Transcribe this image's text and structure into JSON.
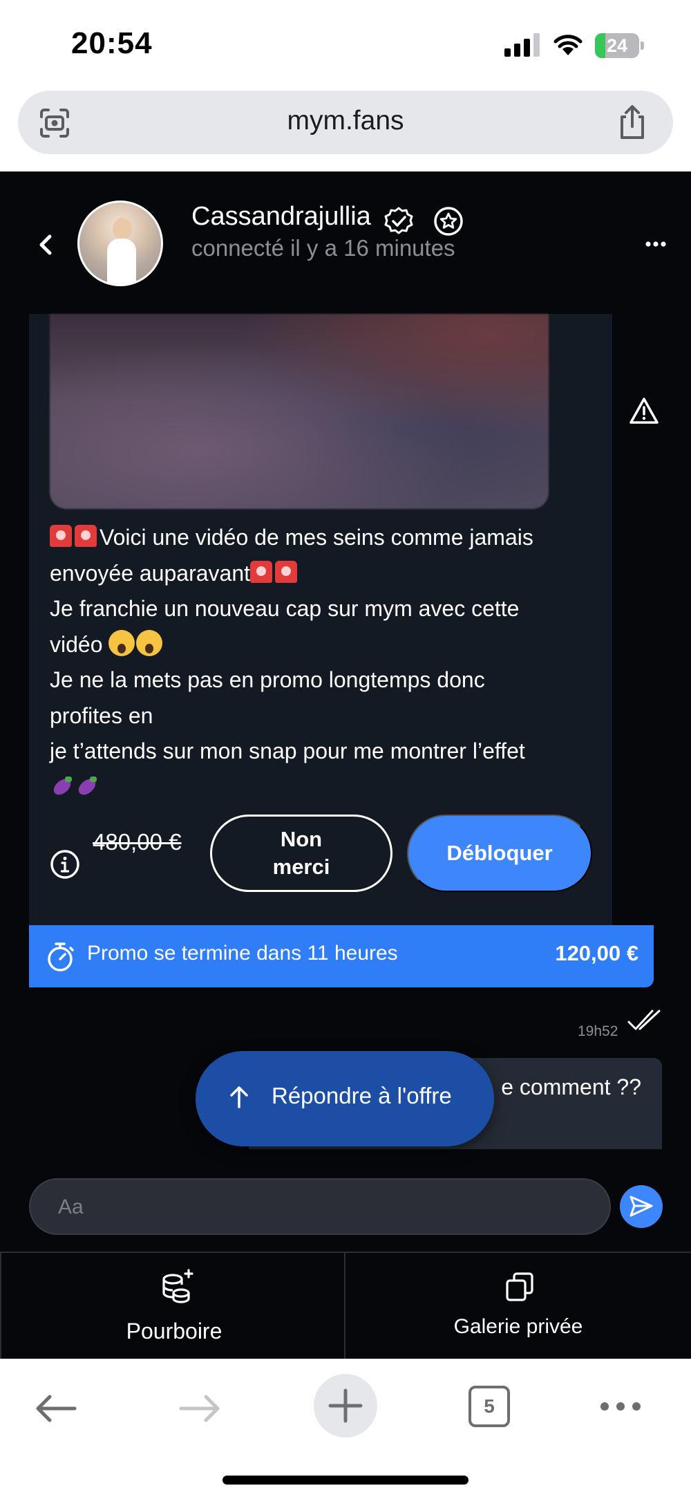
{
  "status_bar": {
    "time": "20:54",
    "battery": "24",
    "battery_level": 0.24,
    "battery_color": "#35c759"
  },
  "browser": {
    "url": "mym.fans",
    "tabs_count": "5",
    "icons": [
      "camera-search-icon",
      "share-icon",
      "back-arrow-icon",
      "forward-arrow-icon",
      "plus-icon",
      "tabs-icon",
      "more-icon"
    ]
  },
  "chat_header": {
    "name": "Cassandrajullia",
    "status": "connecté il y a 16 minutes"
  },
  "offer": {
    "message_lines": [
      "Voici une vidéo de mes seins comme jamais",
      "envoyée auparavant",
      "Je franchie un nouveau cap sur mym avec cette",
      "vidéo ",
      "Je ne la mets pas en promo longtemps donc",
      "profites en",
      "je t’attends sur mon snap pour me montrer l’effet"
    ],
    "old_price": "480,00 €",
    "decline_label": "Non merci",
    "unlock_label": "Débloquer",
    "promo_text": "Promo se termine dans 11 heures",
    "promo_price": "120,00 €"
  },
  "sent_message": {
    "time": "19h52",
    "text_visible": "e comment ??"
  },
  "reply_button": {
    "label": "Répondre à l'offre"
  },
  "composer": {
    "placeholder": "Aa"
  },
  "bottom_tabs": {
    "tip_label": "Pourboire",
    "gallery_label": "Galerie privée"
  },
  "colors": {
    "accent": "#3d86fb",
    "promo": "#2f7ef7",
    "reply_button": "#1c4ea6",
    "app_background": "#05070b",
    "card_background": "#141a24"
  }
}
